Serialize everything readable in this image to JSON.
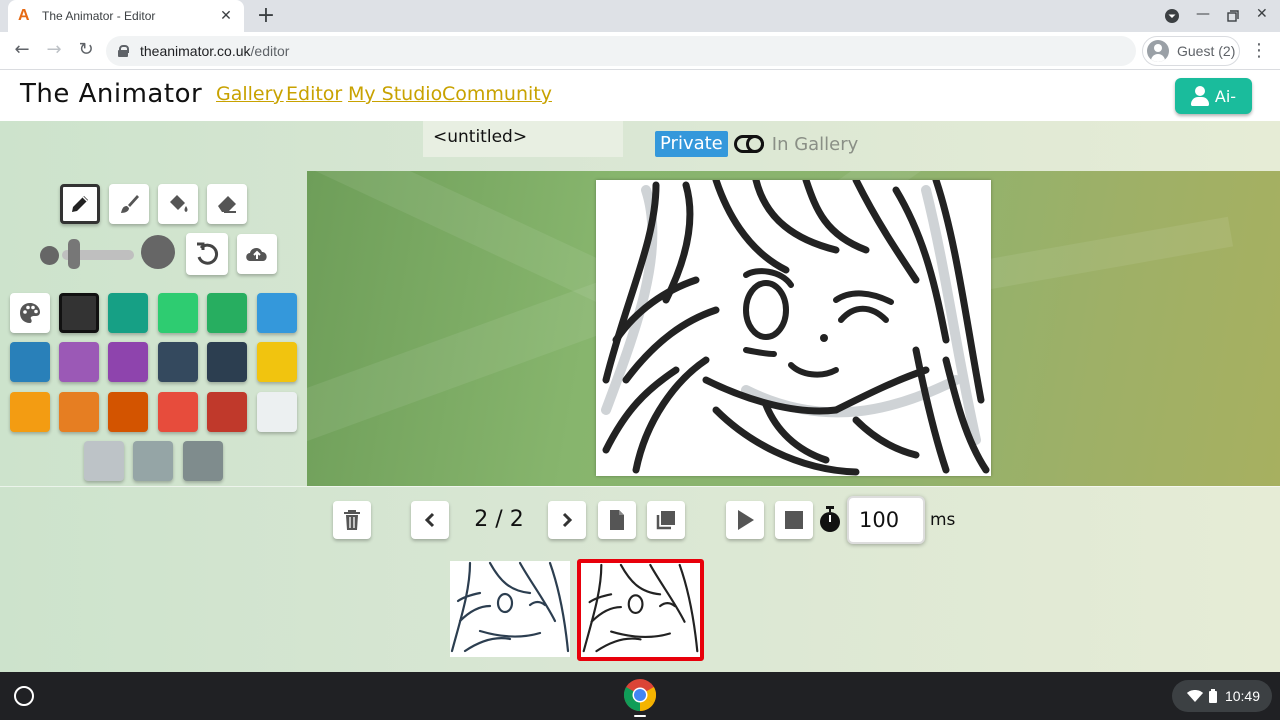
{
  "browser": {
    "tab_title": "The Animator - Editor",
    "favicon_letter": "A",
    "url_host": "theanimator.co.uk",
    "url_path": "/editor",
    "profile_label": "Guest (2)"
  },
  "site": {
    "logo": "The Animator",
    "nav": [
      "Gallery",
      "Editor",
      "My Studio",
      "Community"
    ],
    "user_button": "Ai-"
  },
  "editor": {
    "title_value": "<untitled>",
    "privacy_private": "Private",
    "privacy_gallery": "In Gallery",
    "frame_counter": "2 / 2",
    "frame_ms": "100",
    "ms_label": "ms",
    "brush_size_fraction": 0.1
  },
  "tools": [
    {
      "name": "pencil-icon",
      "active": true
    },
    {
      "name": "brush-icon",
      "active": false
    },
    {
      "name": "fill-bucket-icon",
      "active": false
    },
    {
      "name": "eraser-icon",
      "active": false
    }
  ],
  "palette": {
    "colors": [
      "#333333",
      "#16a085",
      "#2ecc71",
      "#27ae60",
      "#3498db",
      "#2980b9",
      "#9b59b6",
      "#8e44ad",
      "#34495e",
      "#2c3e50",
      "#f1c40f",
      "#f39c12",
      "#e67e22",
      "#d35400",
      "#e74c3c",
      "#c0392b",
      "#ecf0f1",
      "#bdc3c7",
      "#95a5a6",
      "#7f8c8d"
    ],
    "selected_color": "#333333"
  },
  "thumbnails": [
    {
      "label": "frame-1",
      "active": false
    },
    {
      "label": "frame-2",
      "active": true
    }
  ],
  "shelf": {
    "time": "10:49"
  },
  "colors": {
    "accent_teal": "#1abc9c",
    "link_gold": "#c8a200",
    "private_blue": "#3498db",
    "active_frame_red": "#e8000b"
  }
}
